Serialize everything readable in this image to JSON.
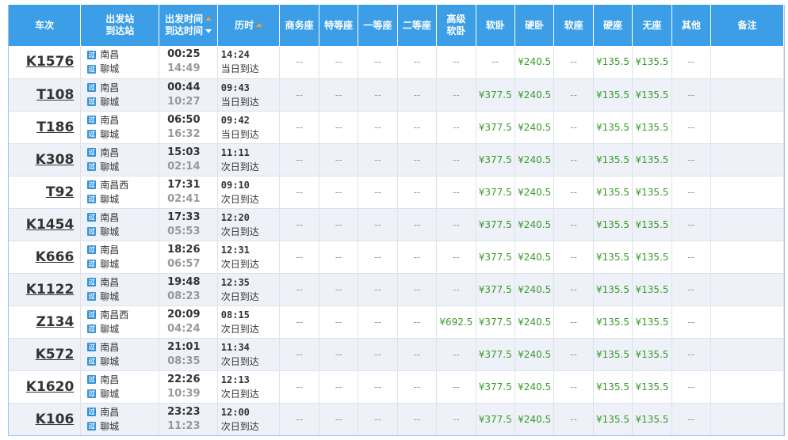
{
  "headers": {
    "train": "车次",
    "station_from": "出发站",
    "station_to": "到达站",
    "time_dep": "出发时间",
    "time_arr": "到达时间",
    "duration": "历时",
    "business": "商务座",
    "premium": "特等座",
    "first": "一等座",
    "second": "二等座",
    "high_soft_1": "高级",
    "high_soft_2": "软卧",
    "soft_sleeper": "软卧",
    "hard_sleeper": "硬卧",
    "soft_seat": "软座",
    "hard_seat": "硬座",
    "standing": "无座",
    "other": "其他",
    "note": "备注"
  },
  "icons": {
    "depart": "始",
    "arrive": "过"
  },
  "rows": [
    {
      "train": "K1576",
      "from": "南昌",
      "to": "聊城",
      "dep": "00:25",
      "arr": "14:49",
      "dur": "14:24",
      "day": "当日到达",
      "business": "--",
      "premium": "--",
      "first": "--",
      "second": "--",
      "high_soft": "--",
      "soft_sleeper": "--",
      "hard_sleeper": "¥240.5",
      "soft_seat": "--",
      "hard_seat": "¥135.5",
      "standing": "¥135.5",
      "other": "--",
      "note": ""
    },
    {
      "train": "T108",
      "from": "南昌",
      "to": "聊城",
      "dep": "00:44",
      "arr": "10:27",
      "dur": "09:43",
      "day": "当日到达",
      "business": "--",
      "premium": "--",
      "first": "--",
      "second": "--",
      "high_soft": "--",
      "soft_sleeper": "¥377.5",
      "hard_sleeper": "¥240.5",
      "soft_seat": "--",
      "hard_seat": "¥135.5",
      "standing": "¥135.5",
      "other": "--",
      "note": ""
    },
    {
      "train": "T186",
      "from": "南昌",
      "to": "聊城",
      "dep": "06:50",
      "arr": "16:32",
      "dur": "09:42",
      "day": "当日到达",
      "business": "--",
      "premium": "--",
      "first": "--",
      "second": "--",
      "high_soft": "--",
      "soft_sleeper": "¥377.5",
      "hard_sleeper": "¥240.5",
      "soft_seat": "--",
      "hard_seat": "¥135.5",
      "standing": "¥135.5",
      "other": "--",
      "note": ""
    },
    {
      "train": "K308",
      "from": "南昌",
      "to": "聊城",
      "dep": "15:03",
      "arr": "02:14",
      "dur": "11:11",
      "day": "次日到达",
      "business": "--",
      "premium": "--",
      "first": "--",
      "second": "--",
      "high_soft": "--",
      "soft_sleeper": "¥377.5",
      "hard_sleeper": "¥240.5",
      "soft_seat": "--",
      "hard_seat": "¥135.5",
      "standing": "¥135.5",
      "other": "--",
      "note": ""
    },
    {
      "train": "T92",
      "from": "南昌西",
      "to": "聊城",
      "dep": "17:31",
      "arr": "02:41",
      "dur": "09:10",
      "day": "次日到达",
      "business": "--",
      "premium": "--",
      "first": "--",
      "second": "--",
      "high_soft": "--",
      "soft_sleeper": "¥377.5",
      "hard_sleeper": "¥240.5",
      "soft_seat": "--",
      "hard_seat": "¥135.5",
      "standing": "¥135.5",
      "other": "--",
      "note": ""
    },
    {
      "train": "K1454",
      "from": "南昌",
      "to": "聊城",
      "dep": "17:33",
      "arr": "05:53",
      "dur": "12:20",
      "day": "次日到达",
      "business": "--",
      "premium": "--",
      "first": "--",
      "second": "--",
      "high_soft": "--",
      "soft_sleeper": "¥377.5",
      "hard_sleeper": "¥240.5",
      "soft_seat": "--",
      "hard_seat": "¥135.5",
      "standing": "¥135.5",
      "other": "--",
      "note": ""
    },
    {
      "train": "K666",
      "from": "南昌",
      "to": "聊城",
      "dep": "18:26",
      "arr": "06:57",
      "dur": "12:31",
      "day": "次日到达",
      "business": "--",
      "premium": "--",
      "first": "--",
      "second": "--",
      "high_soft": "--",
      "soft_sleeper": "¥377.5",
      "hard_sleeper": "¥240.5",
      "soft_seat": "--",
      "hard_seat": "¥135.5",
      "standing": "¥135.5",
      "other": "--",
      "note": ""
    },
    {
      "train": "K1122",
      "from": "南昌",
      "to": "聊城",
      "dep": "19:48",
      "arr": "08:23",
      "dur": "12:35",
      "day": "次日到达",
      "business": "--",
      "premium": "--",
      "first": "--",
      "second": "--",
      "high_soft": "--",
      "soft_sleeper": "¥377.5",
      "hard_sleeper": "¥240.5",
      "soft_seat": "--",
      "hard_seat": "¥135.5",
      "standing": "¥135.5",
      "other": "--",
      "note": ""
    },
    {
      "train": "Z134",
      "from": "南昌西",
      "to": "聊城",
      "dep": "20:09",
      "arr": "04:24",
      "dur": "08:15",
      "day": "次日到达",
      "business": "--",
      "premium": "--",
      "first": "--",
      "second": "--",
      "high_soft": "¥692.5",
      "soft_sleeper": "¥377.5",
      "hard_sleeper": "¥240.5",
      "soft_seat": "--",
      "hard_seat": "¥135.5",
      "standing": "¥135.5",
      "other": "--",
      "note": ""
    },
    {
      "train": "K572",
      "from": "南昌",
      "to": "聊城",
      "dep": "21:01",
      "arr": "08:35",
      "dur": "11:34",
      "day": "次日到达",
      "business": "--",
      "premium": "--",
      "first": "--",
      "second": "--",
      "high_soft": "--",
      "soft_sleeper": "¥377.5",
      "hard_sleeper": "¥240.5",
      "soft_seat": "--",
      "hard_seat": "¥135.5",
      "standing": "¥135.5",
      "other": "--",
      "note": ""
    },
    {
      "train": "K1620",
      "from": "南昌",
      "to": "聊城",
      "dep": "22:26",
      "arr": "10:39",
      "dur": "12:13",
      "day": "次日到达",
      "business": "--",
      "premium": "--",
      "first": "--",
      "second": "--",
      "high_soft": "--",
      "soft_sleeper": "¥377.5",
      "hard_sleeper": "¥240.5",
      "soft_seat": "--",
      "hard_seat": "¥135.5",
      "standing": "¥135.5",
      "other": "--",
      "note": ""
    },
    {
      "train": "K106",
      "from": "南昌",
      "to": "聊城",
      "dep": "23:23",
      "arr": "11:23",
      "dur": "12:00",
      "day": "次日到达",
      "business": "--",
      "premium": "--",
      "first": "--",
      "second": "--",
      "high_soft": "--",
      "soft_sleeper": "¥377.5",
      "hard_sleeper": "¥240.5",
      "soft_seat": "--",
      "hard_seat": "¥135.5",
      "standing": "¥135.5",
      "other": "--",
      "note": ""
    }
  ]
}
